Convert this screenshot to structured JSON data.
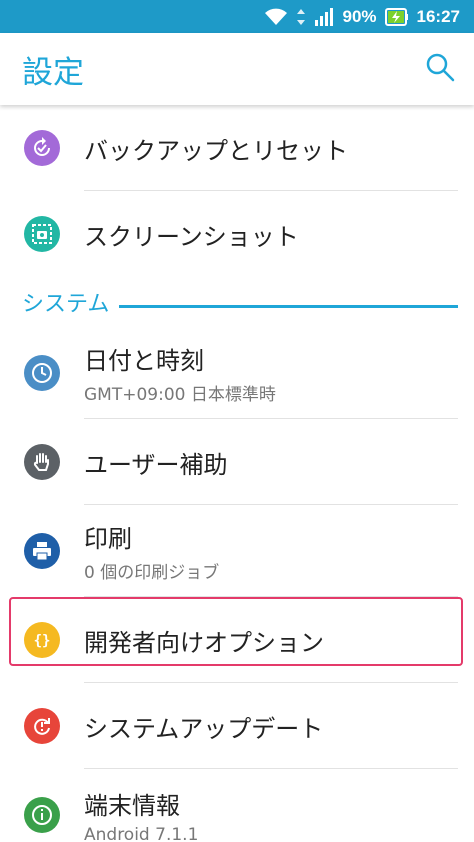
{
  "status_bar": {
    "battery_percent": "90%",
    "time": "16:27",
    "colors": {
      "background": "#1e9ac8"
    },
    "icons": [
      "wifi-icon",
      "data-arrows-icon",
      "signal-icon",
      "battery-charging-icon"
    ]
  },
  "header": {
    "title": "設定",
    "search_icon": "search-icon"
  },
  "items_top": [
    {
      "title": "バックアップとリセット",
      "icon": "backup-icon",
      "color": "#a36ad8"
    },
    {
      "title": "スクリーンショット",
      "icon": "screenshot-icon",
      "color": "#22b7a4"
    }
  ],
  "section": {
    "label": "システム"
  },
  "items_system": [
    {
      "title": "日付と時刻",
      "subtitle": "GMT+09:00 日本標準時",
      "icon": "clock-icon",
      "color": "#4a8ec6"
    },
    {
      "title": "ユーザー補助",
      "icon": "hand-icon",
      "color": "#5c6166"
    },
    {
      "title": "印刷",
      "subtitle": "0 個の印刷ジョブ",
      "icon": "printer-icon",
      "color": "#1f5fa8"
    },
    {
      "title": "開発者向けオプション",
      "icon": "braces-icon",
      "color": "#f5b921"
    },
    {
      "title": "システムアップデート",
      "icon": "update-icon",
      "color": "#e7453a"
    },
    {
      "title": "端末情報",
      "subtitle": "Android 7.1.1",
      "icon": "info-icon",
      "color": "#3aa04a"
    }
  ],
  "colors": {
    "accent": "#1fa6d8",
    "highlight_border": "#e43a6a"
  }
}
